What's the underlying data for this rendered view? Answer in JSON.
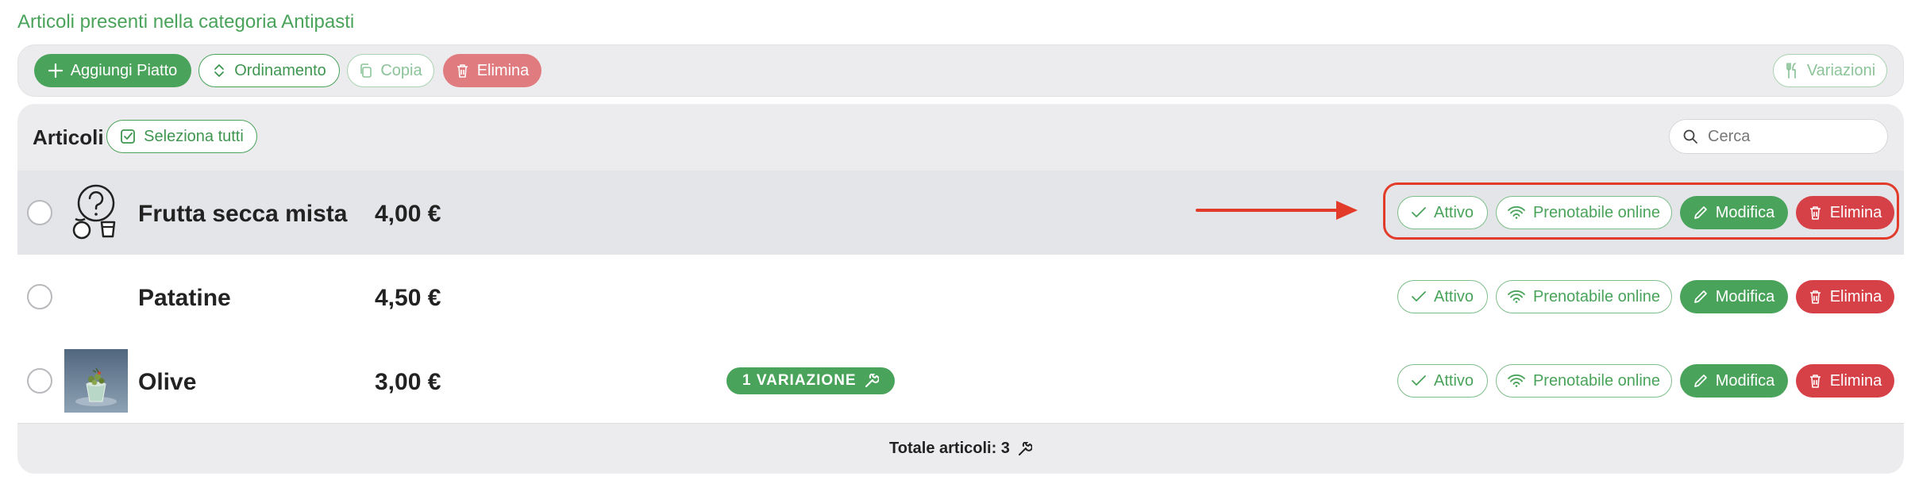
{
  "heading": "Articoli presenti nella categoria Antipasti",
  "toolbar": {
    "add_label": "Aggiungi Piatto",
    "sort_label": "Ordinamento",
    "copy_label": "Copia",
    "delete_label": "Elimina",
    "variations_label": "Variazioni"
  },
  "panel": {
    "title": "Articoli",
    "select_all_label": "Seleziona tutti",
    "search_placeholder": "Cerca"
  },
  "items": [
    {
      "name": "Frutta secca mista",
      "price": "4,00 €",
      "image": "placeholder-food-icon",
      "selected": false
    },
    {
      "name": "Patatine",
      "price": "4,50 €",
      "image": "none",
      "selected": false
    },
    {
      "name": "Olive",
      "price": "3,00 €",
      "image": "olive-photo",
      "selected": false,
      "variation_badge": "1 VARIAZIONE"
    }
  ],
  "actions": {
    "active_label": "Attivo",
    "bookable_label": "Prenotabile online",
    "edit_label": "Modifica",
    "delete_label": "Elimina"
  },
  "footer": {
    "total_label": "Totale articoli: 3"
  },
  "colors": {
    "accent_green": "#4aa35a",
    "danger_red": "#d64047",
    "annotation_red": "#e23b2a"
  }
}
